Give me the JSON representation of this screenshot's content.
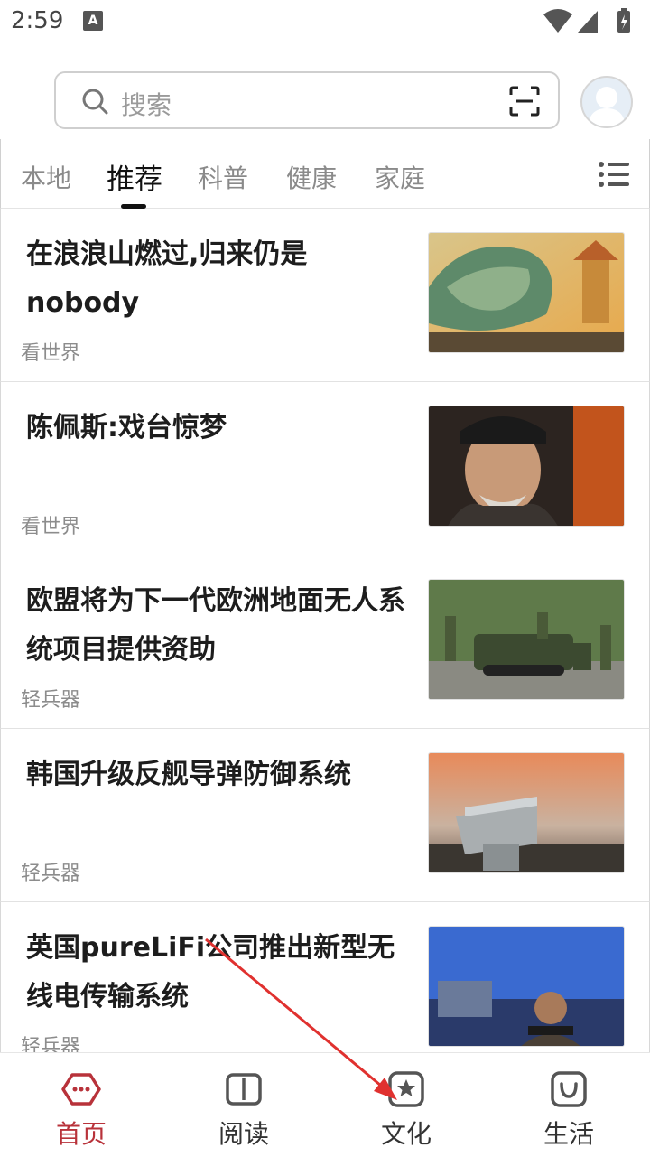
{
  "status": {
    "time": "2:59"
  },
  "search": {
    "placeholder": "搜索"
  },
  "tabs": [
    {
      "label": "本地"
    },
    {
      "label": "推荐"
    },
    {
      "label": "科普"
    },
    {
      "label": "健康"
    },
    {
      "label": "家庭"
    }
  ],
  "feed": [
    {
      "title": "在浪浪山燃过,归来仍是nobody",
      "source": "看世界"
    },
    {
      "title": "陈佩斯:戏台惊梦",
      "source": "看世界"
    },
    {
      "title": "欧盟将为下一代欧洲地面无人系统项目提供资助",
      "source": "轻兵器"
    },
    {
      "title": "韩国升级反舰导弹防御系统",
      "source": "轻兵器"
    },
    {
      "title": "英国pureLiFi公司推出新型无线电传输系统",
      "source": "轻兵器"
    }
  ],
  "nav": [
    {
      "label": "首页"
    },
    {
      "label": "阅读"
    },
    {
      "label": "文化"
    },
    {
      "label": "生活"
    }
  ],
  "colors": {
    "accent": "#b8323a",
    "arrow": "#e0312f"
  }
}
